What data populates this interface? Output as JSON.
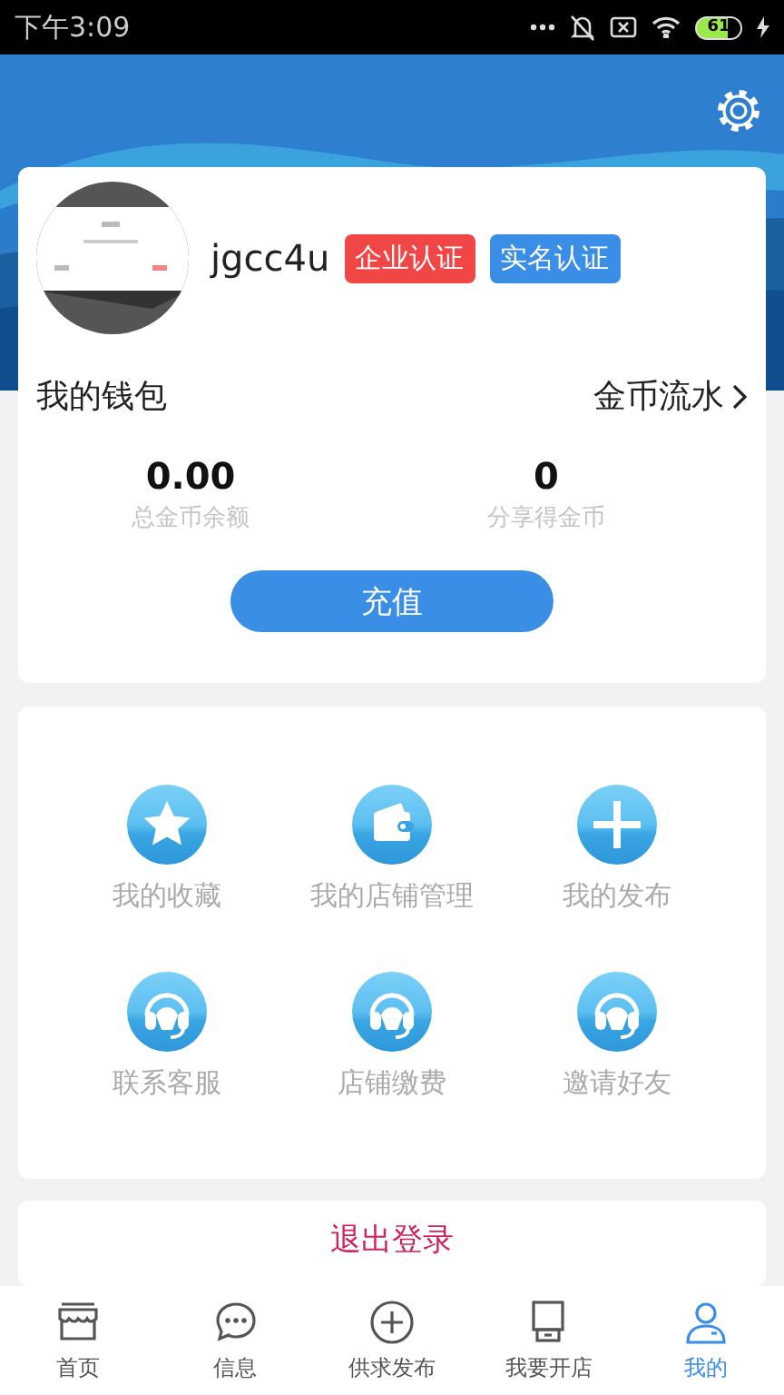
{
  "status_bar": {
    "time": "下午3:09",
    "battery": "61"
  },
  "profile": {
    "username": "jgcc4u",
    "badges": [
      {
        "label": "企业认证",
        "color": "#f04646"
      },
      {
        "label": "实名认证",
        "color": "#3a8ee6"
      }
    ]
  },
  "wallet": {
    "title": "我的钱包",
    "link": "金币流水"
  },
  "stats": [
    {
      "value": "0.00",
      "label": "总金币余额"
    },
    {
      "value": "0",
      "label": "分享得金币"
    }
  ],
  "recharge_button": "充值",
  "menu": [
    {
      "label": "我的收藏",
      "kind": "star"
    },
    {
      "label": "我的店铺管理",
      "kind": "wallet"
    },
    {
      "label": "我的发布",
      "kind": "plus"
    },
    {
      "label": "联系客服",
      "kind": "headset"
    },
    {
      "label": "店铺缴费",
      "kind": "headset"
    },
    {
      "label": "邀请好友",
      "kind": "headset"
    }
  ],
  "logout_button": "退出登录",
  "tabs": [
    {
      "label": "首页",
      "kind": "store",
      "selected": false
    },
    {
      "label": "信息",
      "kind": "chat",
      "selected": false
    },
    {
      "label": "供求发布",
      "kind": "plus",
      "selected": false
    },
    {
      "label": "我要开店",
      "kind": "kiosk",
      "selected": false
    },
    {
      "label": "我的",
      "kind": "person",
      "selected": true
    }
  ]
}
